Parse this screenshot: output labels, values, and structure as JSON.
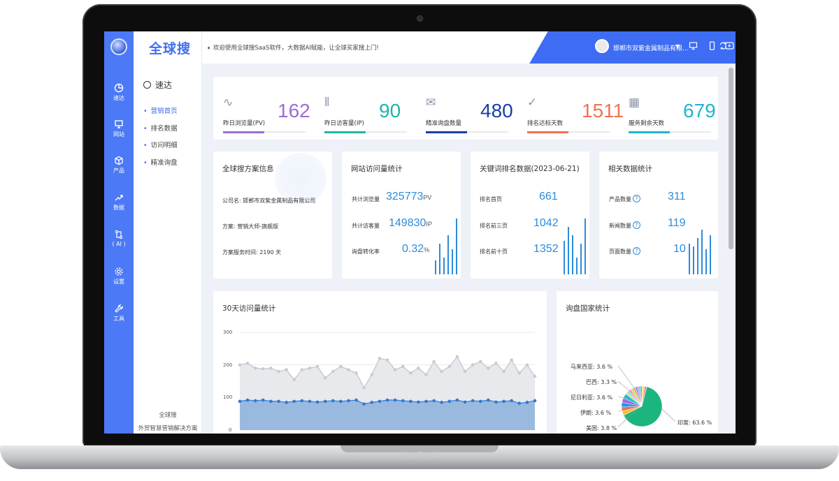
{
  "device": {
    "brand": "MacBook"
  },
  "app": {
    "logo": "全球搜",
    "announcement": "欢迎使用全球搜SaaS软件，大数据AI赋能，让全球买家搜上门!",
    "company": "邯郸市双紫金属制品有限...",
    "top_icons": [
      "monitor-icon",
      "phone-icon",
      "play-icon",
      "refresh-icon"
    ]
  },
  "rail": {
    "items": [
      {
        "label": "速达",
        "icon": "pie-icon"
      },
      {
        "label": "网站",
        "icon": "screen-icon"
      },
      {
        "label": "产品",
        "icon": "box-icon"
      },
      {
        "label": "数据",
        "icon": "trend-icon"
      },
      {
        "label": "( AI )",
        "icon": "ai-icon"
      },
      {
        "label": "设置",
        "icon": "gear-icon"
      },
      {
        "label": "工具",
        "icon": "wrench-icon"
      }
    ]
  },
  "subnav": {
    "title": "速达",
    "items": [
      "营销首页",
      "排名数据",
      "访问明细",
      "精准询盘"
    ],
    "active": 0,
    "footer1": "全球搜",
    "footer2": "外贸智慧营销解决方案"
  },
  "kpis": [
    {
      "value": "162",
      "label": "昨日浏览量(PV)",
      "color": "#9b6ed6",
      "icon": "pulse-icon",
      "fill": 0.5
    },
    {
      "value": "90",
      "label": "昨日访客量(IP)",
      "color": "#1fb5a8",
      "icon": "bars-icon",
      "fill": 0.5
    },
    {
      "value": "480",
      "label": "精准询盘数量",
      "color": "#1a3fa8",
      "icon": "mail-icon",
      "fill": 0.5
    },
    {
      "value": "1511",
      "label": "排名达标天数",
      "color": "#f07256",
      "icon": "check-icon",
      "fill": 0.5
    },
    {
      "value": "679",
      "label": "服务剩余天数",
      "color": "#1fb5cf",
      "icon": "calendar-icon",
      "fill": 0.5
    }
  ],
  "plan": {
    "title": "全球搜方案信息",
    "company": "公司名: 邯郸市双紫金属制品有限公司",
    "scheme": "方案: 营销大师-旗舰版",
    "time": "方案服务时间: 2190 天"
  },
  "visits": {
    "title": "网站访问量统计",
    "rows": [
      {
        "label": "共计浏览量",
        "value": "325773",
        "unit": "PV"
      },
      {
        "label": "共计访客量",
        "value": "149830",
        "unit": "IP"
      },
      {
        "label": "询盘转化率",
        "value": "0.32",
        "unit": "%"
      }
    ],
    "mini_bars": [
      0.25,
      0.55,
      0.3,
      0.7,
      0.45,
      1.0
    ]
  },
  "ranks": {
    "title": "关键词排名数据(2023-06-21)",
    "rows": [
      {
        "label": "排名首页",
        "value": "661"
      },
      {
        "label": "排名前三页",
        "value": "1042"
      },
      {
        "label": "排名前十页",
        "value": "1352"
      }
    ],
    "mini_bars": [
      0.6,
      0.85,
      0.7,
      0.3,
      0.55,
      1.0
    ]
  },
  "related": {
    "title": "相关数据统计",
    "rows": [
      {
        "label": "产品数量",
        "value": "311"
      },
      {
        "label": "新闻数量",
        "value": "119"
      },
      {
        "label": "页面数量",
        "value": "10"
      }
    ],
    "mini_bars": [
      0.55,
      0.5,
      0.65,
      0.8,
      0.45,
      0.7
    ]
  },
  "chart_data": [
    {
      "type": "area",
      "title": "30天访问量统计",
      "ylim": [
        0,
        300
      ],
      "yticks": [
        "300",
        "200",
        "100",
        "0"
      ],
      "series": [
        {
          "values": [
            200,
            205,
            190,
            188,
            190,
            180,
            185,
            155,
            185,
            190,
            195,
            160,
            180,
            195,
            185,
            175,
            130,
            170,
            220,
            215,
            185,
            195,
            175,
            190,
            170,
            210,
            180,
            195,
            225,
            180,
            200,
            210,
            190,
            205,
            180,
            215,
            175,
            200,
            165
          ]
        },
        {
          "values": [
            88,
            92,
            90,
            92,
            88,
            88,
            85,
            88,
            90,
            88,
            86,
            88,
            90,
            88,
            90,
            92,
            80,
            85,
            88,
            92,
            92,
            90,
            88,
            86,
            88,
            90,
            85,
            88,
            92,
            86,
            90,
            88,
            92,
            86,
            88,
            90,
            82,
            85,
            90
          ]
        }
      ]
    },
    {
      "type": "pie",
      "title": "询盘国家统计",
      "labels": [
        "印度",
        "马来西亚",
        "巴西",
        "尼日利亚",
        "伊朗",
        "美国"
      ],
      "values": [
        63.6,
        3.6,
        3.3,
        3.6,
        3.6,
        3.8
      ],
      "label_text": [
        "印度: 63.6 %",
        "马来西亚: 3.6 %",
        "巴西: 3.3 %",
        "尼日利亚: 3.6 %",
        "伊朗: 3.6 %",
        "美国: 3.8 %"
      ],
      "colors": [
        "#1bb57e",
        "#f5c13d",
        "#ee6f4a",
        "#2b8ef0",
        "#9c6bd9",
        "#16c2d6"
      ]
    }
  ]
}
